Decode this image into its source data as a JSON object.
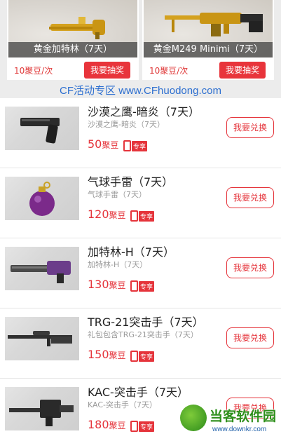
{
  "top_cards": [
    {
      "name": "黄金加特林（7天）",
      "price": "10聚豆/次",
      "button": "我要抽奖"
    },
    {
      "name": "黄金M249 Minimi（7天）",
      "price": "10聚豆/次",
      "button": "我要抽奖"
    }
  ],
  "banner": {
    "text": "CF活动专区 www.CFhuodong.com"
  },
  "items": [
    {
      "title": "沙漠之鹰-暗炎（7天）",
      "subtitle": "沙漠之鹰-暗炎（7天）",
      "price": "50",
      "unit": "聚豆",
      "tag": "专享",
      "button": "我要兑换"
    },
    {
      "title": "气球手雷（7天）",
      "subtitle": "气球手雷（7天）",
      "price": "120",
      "unit": "聚豆",
      "tag": "专享",
      "button": "我要兑换"
    },
    {
      "title": "加特林-H（7天）",
      "subtitle": "加特林-H（7天）",
      "price": "130",
      "unit": "聚豆",
      "tag": "专享",
      "button": "我要兑换"
    },
    {
      "title": "TRG-21突击手（7天）",
      "subtitle": "礼包包含TRG-21突击手（7天）",
      "price": "150",
      "unit": "聚豆",
      "tag": "专享",
      "button": "我要兑换"
    },
    {
      "title": "KAC-突击手（7天）",
      "subtitle": "KAC-突击手（7天）",
      "price": "180",
      "unit": "聚豆",
      "tag": "专享",
      "button": "我要兑换"
    }
  ],
  "watermark": {
    "name": "当客软件园",
    "url": "www.downkr.com"
  },
  "colors": {
    "accent": "#e5343b",
    "banner": "#2d6fd0"
  }
}
